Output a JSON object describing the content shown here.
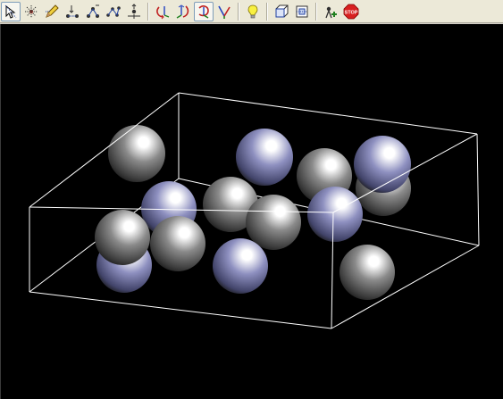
{
  "window": {
    "background": "#000000",
    "toolbar_background": "#ece9d8"
  },
  "toolbar": {
    "groups": [
      [
        {
          "icon": "select-arrow-icon",
          "active": true
        },
        {
          "icon": "select-atoms-icon",
          "active": false
        },
        {
          "icon": "edit-pencil-icon",
          "active": false
        },
        {
          "icon": "measure-distance-icon",
          "active": false
        },
        {
          "icon": "measure-angle-icon",
          "active": false
        },
        {
          "icon": "measure-dihedral-icon",
          "active": false
        },
        {
          "icon": "translate-center-icon",
          "active": false
        }
      ],
      [
        {
          "icon": "rotate-x-icon",
          "active": false
        },
        {
          "icon": "rotate-y-icon",
          "active": false
        },
        {
          "icon": "rotate-z-icon",
          "active": true
        },
        {
          "icon": "rotate-free-icon",
          "active": false
        }
      ],
      [
        {
          "icon": "lightbulb-icon",
          "active": false
        }
      ],
      [
        {
          "icon": "cell-box-icon",
          "active": false
        },
        {
          "icon": "cell-face-icon",
          "active": false
        }
      ],
      [
        {
          "icon": "add-atom-icon",
          "active": false
        },
        {
          "icon": "stop-icon",
          "active": false
        }
      ]
    ]
  },
  "scene": {
    "atom_species": {
      "grey": {
        "color": "#8a8a8a",
        "highlight": "#ffffff"
      },
      "lavender": {
        "color": "#8e90c0",
        "highlight": "#ffffff"
      }
    },
    "cell_outline_color": "#ffffff"
  }
}
